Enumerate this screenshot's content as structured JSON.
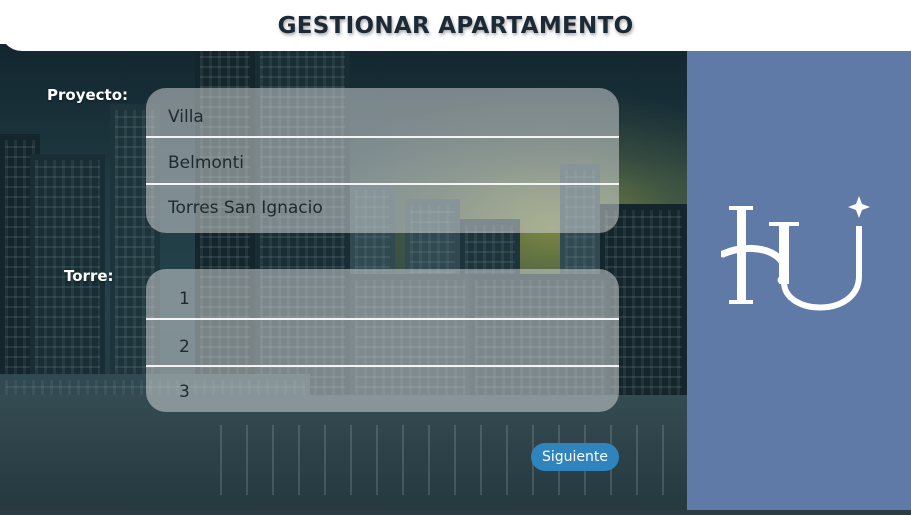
{
  "header": {
    "title": "GESTIONAR APARTAMENTO"
  },
  "form": {
    "project_label": "Proyecto:",
    "projects": [
      "Villa",
      "Belmonti",
      "Torres San Ignacio"
    ],
    "tower_label": "Torre:",
    "towers": [
      "1",
      "2",
      "3"
    ],
    "next_label": "Siguiente"
  },
  "colors": {
    "side_panel": "#5f7aa6",
    "next_button": "#2f84bd",
    "title": "#1b2a36"
  },
  "icons": {
    "logo": "hu-monogram-logo"
  }
}
